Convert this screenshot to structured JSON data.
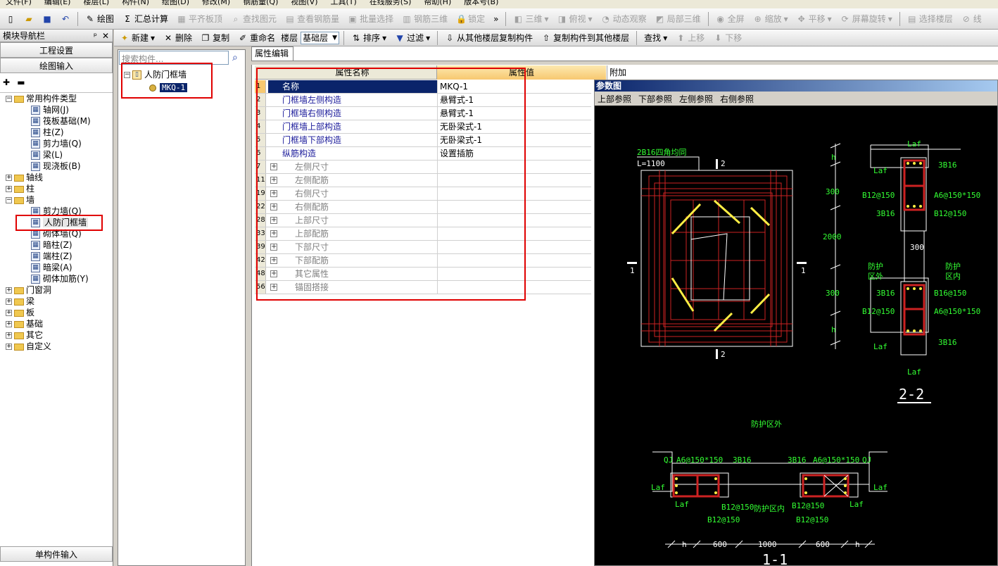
{
  "menu": [
    "文件(F)",
    "编辑(E)",
    "楼层(L)",
    "构件(N)",
    "绘图(D)",
    "修改(M)",
    "钢筋量(Q)",
    "视图(V)",
    "工具(T)",
    "在线服务(S)",
    "帮助(H)",
    "版本号(B)"
  ],
  "toolbar1": {
    "draw": "绘图",
    "sum": "汇总计算",
    "flat_top": "平齐板顶",
    "find_elem": "查找图元",
    "view_rebar": "查看钢筋量",
    "batch_select": "批量选择",
    "rebar_3d": "钢筋三维",
    "lock": "锁定",
    "view3d": "三维",
    "top_view": "俯视",
    "dynamic": "动态观察",
    "local3d": "局部三维",
    "fullscreen": "全屏",
    "zoom": "缩放",
    "pan": "平移",
    "rotate": "屏幕旋转",
    "select_floor": "选择楼层",
    "line": "线"
  },
  "nav": {
    "title": "模块导航栏",
    "project_settings": "工程设置",
    "draw_input": "绘图输入",
    "bottom_btn": "单构件输入",
    "tree": [
      {
        "label": "常用构件类型",
        "type": "folder",
        "open": true
      },
      {
        "label": "轴网(J)",
        "type": "item"
      },
      {
        "label": "筏板基础(M)",
        "type": "item"
      },
      {
        "label": "柱(Z)",
        "type": "item"
      },
      {
        "label": "剪力墙(Q)",
        "type": "item"
      },
      {
        "label": "梁(L)",
        "type": "item"
      },
      {
        "label": "现浇板(B)",
        "type": "item"
      },
      {
        "label": "轴线",
        "type": "folder"
      },
      {
        "label": "柱",
        "type": "folder"
      },
      {
        "label": "墙",
        "type": "folder",
        "open": true
      },
      {
        "label": "剪力墙(Q)",
        "type": "item"
      },
      {
        "label": "人防门框墙",
        "type": "item",
        "selected": true
      },
      {
        "label": "砌体墙(Q)",
        "type": "item"
      },
      {
        "label": "暗柱(Z)",
        "type": "item"
      },
      {
        "label": "端柱(Z)",
        "type": "item"
      },
      {
        "label": "暗梁(A)",
        "type": "item"
      },
      {
        "label": "砌体加筋(Y)",
        "type": "item"
      },
      {
        "label": "门窗洞",
        "type": "folder"
      },
      {
        "label": "梁",
        "type": "folder"
      },
      {
        "label": "板",
        "type": "folder"
      },
      {
        "label": "基础",
        "type": "folder"
      },
      {
        "label": "其它",
        "type": "folder"
      },
      {
        "label": "自定义",
        "type": "folder"
      }
    ]
  },
  "toolbar2": {
    "new": "新建",
    "delete": "删除",
    "copy": "复制",
    "rename": "重命名",
    "floor_label": "楼层",
    "floor_value": "基础层",
    "sort": "排序",
    "filter": "过滤",
    "copy_from": "从其他楼层复制构件",
    "copy_to": "复制构件到其他楼层",
    "find": "查找",
    "up": "上移",
    "down": "下移"
  },
  "component_list": {
    "search_placeholder": "搜索构件...",
    "root": "人防门框墙",
    "child": "MKQ-1"
  },
  "property_editor": {
    "tab": "属性编辑",
    "col_name": "属性名称",
    "col_value": "属性值",
    "col_extra": "附加",
    "rows": [
      {
        "num": "1",
        "name": "名称",
        "value": "MKQ-1",
        "selected": true
      },
      {
        "num": "2",
        "name": "门框墙左侧构造",
        "value": "悬臂式-1"
      },
      {
        "num": "3",
        "name": "门框墙右侧构造",
        "value": "悬臂式-1"
      },
      {
        "num": "4",
        "name": "门框墙上部构造",
        "value": "无卧梁式-1"
      },
      {
        "num": "5",
        "name": "门框墙下部构造",
        "value": "无卧梁式-1"
      },
      {
        "num": "6",
        "name": "纵筋构造",
        "value": "设置插筋"
      },
      {
        "num": "7",
        "name": "左侧尺寸",
        "value": "",
        "group": true
      },
      {
        "num": "11",
        "name": "左侧配筋",
        "value": "",
        "group": true
      },
      {
        "num": "19",
        "name": "右侧尺寸",
        "value": "",
        "group": true
      },
      {
        "num": "22",
        "name": "右侧配筋",
        "value": "",
        "group": true
      },
      {
        "num": "28",
        "name": "上部尺寸",
        "value": "",
        "group": true
      },
      {
        "num": "33",
        "name": "上部配筋",
        "value": "",
        "group": true
      },
      {
        "num": "39",
        "name": "下部尺寸",
        "value": "",
        "group": true
      },
      {
        "num": "42",
        "name": "下部配筋",
        "value": "",
        "group": true
      },
      {
        "num": "48",
        "name": "其它属性",
        "value": "",
        "group": true
      },
      {
        "num": "56",
        "name": "锚固搭接",
        "value": "",
        "group": true
      }
    ]
  },
  "param_view": {
    "title": "参数图",
    "tabs": [
      "上部参照",
      "下部参照",
      "左侧参照",
      "右侧参照"
    ],
    "labels": {
      "corner_bars": "2B16四角均同",
      "L": "L=1100",
      "sec2": "2",
      "sec1": "1",
      "laf": "Laf",
      "b3b16": "3B16",
      "b12": "B12@150",
      "a6": "A6@150*150",
      "b16_150": "B16@150",
      "d300": "300",
      "d2000": "2000",
      "h": "h",
      "protect_out": "防护区外",
      "protect_in": "防护区内",
      "protect_out_v": "防护\n区外",
      "protect_in_v": "防护\n区内",
      "title22": "2-2",
      "title11": "1-1",
      "qj": "QJ",
      "d600": "600",
      "d1000": "1000"
    }
  },
  "colors": {
    "highlight_red": "#e00000",
    "select_blue": "#0a246a",
    "cad_green": "#33ff33",
    "cad_red": "#cc2222",
    "cad_yellow": "#ffee44"
  }
}
